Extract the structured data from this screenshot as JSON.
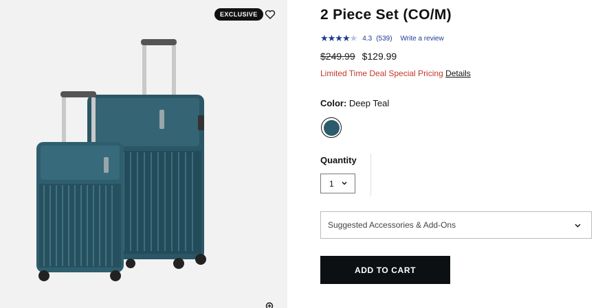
{
  "gallery": {
    "badge": "EXCLUSIVE",
    "icons": {
      "wishlist": "heart-icon",
      "zoom": "zoom-in-icon"
    },
    "product_color_hex": "#2d5a6c"
  },
  "product": {
    "title": "2 Piece Set (CO/M)",
    "rating": {
      "stars_icon": "star-rating-icon",
      "value": "4.3",
      "count": "(539)",
      "write_review": "Write a review",
      "accent": "#1f3a93"
    },
    "price": {
      "original": "$249.99",
      "sale": "$129.99"
    },
    "deal": {
      "text": "Limited Time Deal Special Pricing",
      "link": "Details",
      "color": "#c0392b"
    },
    "color": {
      "label": "Color:",
      "value": "Deep Teal",
      "swatch_hex": "#2d5a6c"
    },
    "quantity": {
      "label": "Quantity",
      "value": "1"
    },
    "accessories": {
      "label": "Suggested Accessories & Add-Ons"
    },
    "add_to_cart": "ADD TO CART"
  }
}
